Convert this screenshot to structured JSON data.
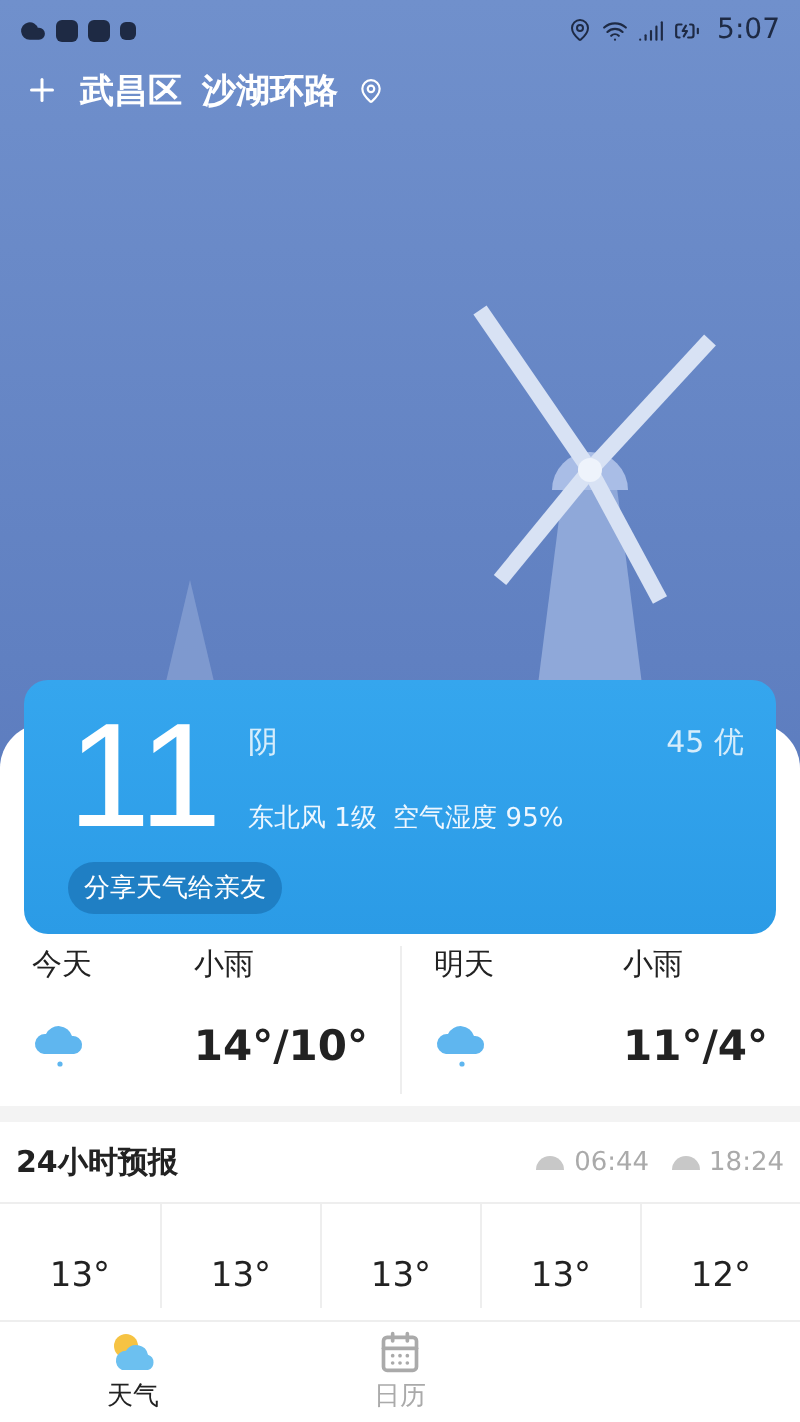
{
  "status_bar": {
    "time": "5:07"
  },
  "location": {
    "district": "武昌区",
    "street": "沙湖环路"
  },
  "current": {
    "temperature": "11",
    "condition": "阴",
    "aqi": "45 优",
    "wind": "东北风 1级",
    "humidity": "空气湿度 95%",
    "share_button": "分享天气给亲友"
  },
  "daily": [
    {
      "day": "今天",
      "condition": "小雨",
      "temps": "14°/10°"
    },
    {
      "day": "明天",
      "condition": "小雨",
      "temps": "11°/4°"
    }
  ],
  "hourly": {
    "title": "24小时预报",
    "sunrise": "06:44",
    "sunset": "18:24",
    "temps": [
      "13°",
      "13°",
      "13°",
      "13°",
      "12°"
    ]
  },
  "nav": [
    {
      "kind": "weather",
      "label": "天气",
      "selected": true
    },
    {
      "kind": "calendar",
      "label": "日历",
      "selected": false
    }
  ]
}
